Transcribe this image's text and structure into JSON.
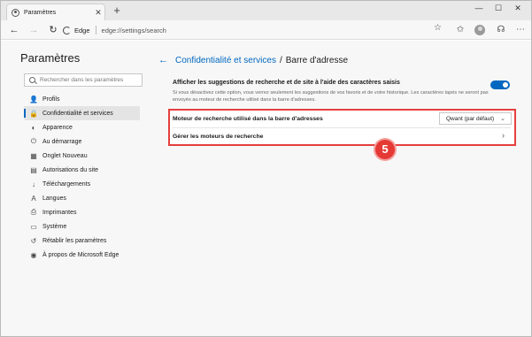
{
  "browser": {
    "tab_title": "Paramètres",
    "tab_close": "✕",
    "new_tab": "+",
    "address_label": "Edge",
    "address_url": "edge://settings/search",
    "win_minimize": "—",
    "win_maximize": "☐",
    "win_close": "✕"
  },
  "sidebar": {
    "title": "Paramètres",
    "search_placeholder": "Rechercher dans les paramètres",
    "items": [
      {
        "label": "Profils",
        "icon": "person-icon",
        "glyph": "👤"
      },
      {
        "label": "Confidentialité et services",
        "icon": "lock-icon",
        "glyph": "🔒",
        "active": true
      },
      {
        "label": "Apparence",
        "icon": "appearance-icon",
        "glyph": "◐"
      },
      {
        "label": "Au démarrage",
        "icon": "power-icon",
        "glyph": "⏻"
      },
      {
        "label": "Onglet Nouveau",
        "icon": "grid-icon",
        "glyph": "▦"
      },
      {
        "label": "Autorisations du site",
        "icon": "site-icon",
        "glyph": "▤"
      },
      {
        "label": "Téléchargements",
        "icon": "download-icon",
        "glyph": "↓"
      },
      {
        "label": "Langues",
        "icon": "language-icon",
        "glyph": "A"
      },
      {
        "label": "Imprimantes",
        "icon": "printer-icon",
        "glyph": "⎙"
      },
      {
        "label": "Système",
        "icon": "system-icon",
        "glyph": "▭"
      },
      {
        "label": "Rétablir les paramètres",
        "icon": "reset-icon",
        "glyph": "↺"
      },
      {
        "label": "À propos de Microsoft Edge",
        "icon": "edge-icon",
        "glyph": "◉"
      }
    ]
  },
  "main": {
    "breadcrumb_link": "Confidentialité et services",
    "breadcrumb_sep": "/",
    "breadcrumb_current": "Barre d'adresse",
    "suggestions_title": "Afficher les suggestions de recherche et de site à l'aide des caractères saisis",
    "suggestions_desc": "Si vous désactivez cette option, vous verrez seulement les suggestions de vos favoris et de votre historique. Les caractères tapés ne seront pas envoyés au moteur de recherche utilisé dans la barre d'adresses.",
    "suggestions_enabled": true,
    "engine_label": "Moteur de recherche utilisé dans la barre d'adresses",
    "engine_value": "Qwant (par défaut)",
    "manage_label": "Gérer les moteurs de recherche"
  },
  "annotation": {
    "badge_number": "5",
    "highlight_color": "#e53e3e"
  },
  "colors": {
    "accent": "#0067c0"
  }
}
